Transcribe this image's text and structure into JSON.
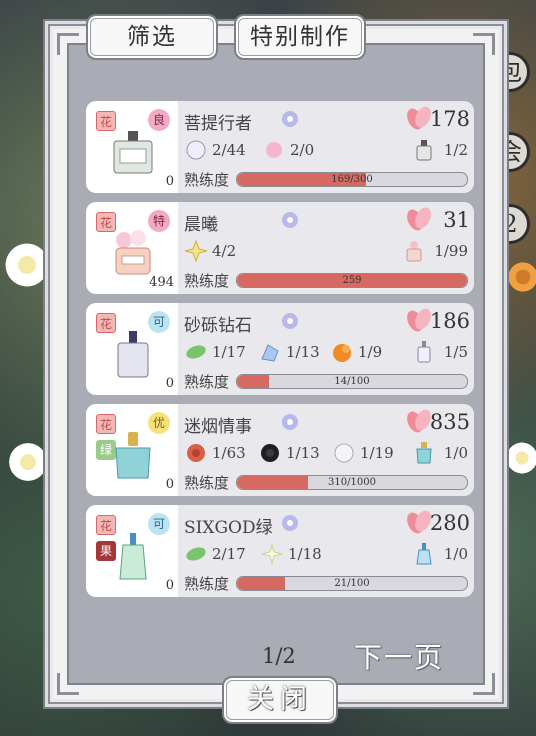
{
  "tabs": {
    "filter": "筛选",
    "special": "特别制作"
  },
  "background_signs": [
    "包",
    "会",
    "2"
  ],
  "cards": [
    {
      "tag1": "花",
      "tag2": "",
      "rank": "良",
      "rank_color": "pink",
      "name": "菩提行者",
      "count": "178",
      "bottle_count": "0",
      "mats": [
        {
          "icon": "white-rose-icon",
          "text": "2/44"
        },
        {
          "icon": "pink-flower-icon",
          "text": "2/0"
        }
      ],
      "right_mat": {
        "icon": "perfume-bottle-icon",
        "text": "1/2"
      },
      "prof_label": "熟练度",
      "progress_text": "169/300",
      "progress": 0.56
    },
    {
      "tag1": "花",
      "tag2": "",
      "rank": "特",
      "rank_color": "pink",
      "name": "晨曦",
      "count": "31",
      "bottle_count": "494",
      "mats": [
        {
          "icon": "yellow-lily-icon",
          "text": "4/2"
        }
      ],
      "right_mat": {
        "icon": "pink-bottle-icon",
        "text": "1/99"
      },
      "prof_label": "熟练度",
      "progress_text": "259",
      "progress": 1.0
    },
    {
      "tag1": "花",
      "tag2": "",
      "rank": "可",
      "rank_color": "blue",
      "name": "砂砾钻石",
      "count": "186",
      "bottle_count": "0",
      "mats": [
        {
          "icon": "mint-leaf-icon",
          "text": "1/17"
        },
        {
          "icon": "blue-crystal-icon",
          "text": "1/13"
        },
        {
          "icon": "orange-icon",
          "text": "1/9"
        }
      ],
      "right_mat": {
        "icon": "clear-bottle-icon",
        "text": "1/5"
      },
      "prof_label": "熟练度",
      "progress_text": "14/100",
      "progress": 0.14
    },
    {
      "tag1": "花",
      "tag2": "绿",
      "tag2_color": "green",
      "rank": "优",
      "rank_color": "yellow",
      "name": "迷烟情事",
      "count": "835",
      "bottle_count": "0",
      "mats": [
        {
          "icon": "red-rose-icon",
          "text": "1/63"
        },
        {
          "icon": "black-rose-icon",
          "text": "1/13"
        },
        {
          "icon": "white-flower-icon",
          "text": "1/19"
        }
      ],
      "right_mat": {
        "icon": "teal-bottle-icon",
        "text": "1/0"
      },
      "prof_label": "熟练度",
      "progress_text": "310/1000",
      "progress": 0.31
    },
    {
      "tag1": "花",
      "tag2": "果",
      "tag2_color": "red",
      "rank": "可",
      "rank_color": "blue",
      "name": "SIXGOD绿",
      "count": "280",
      "bottle_count": "0",
      "mats": [
        {
          "icon": "mint-leaf-icon",
          "text": "2/17"
        },
        {
          "icon": "white-lily-icon",
          "text": "1/18"
        }
      ],
      "right_mat": {
        "icon": "blue-bottle-icon",
        "text": "1/0"
      },
      "prof_label": "熟练度",
      "progress_text": "21/100",
      "progress": 0.21
    }
  ],
  "footer": {
    "page": "1/2",
    "next": "下一页",
    "close": "关闭"
  },
  "colors": {
    "progress_fill": "#d66a63",
    "panel_bg": "#a9abb5",
    "card_bg": "#e8e8ed"
  }
}
